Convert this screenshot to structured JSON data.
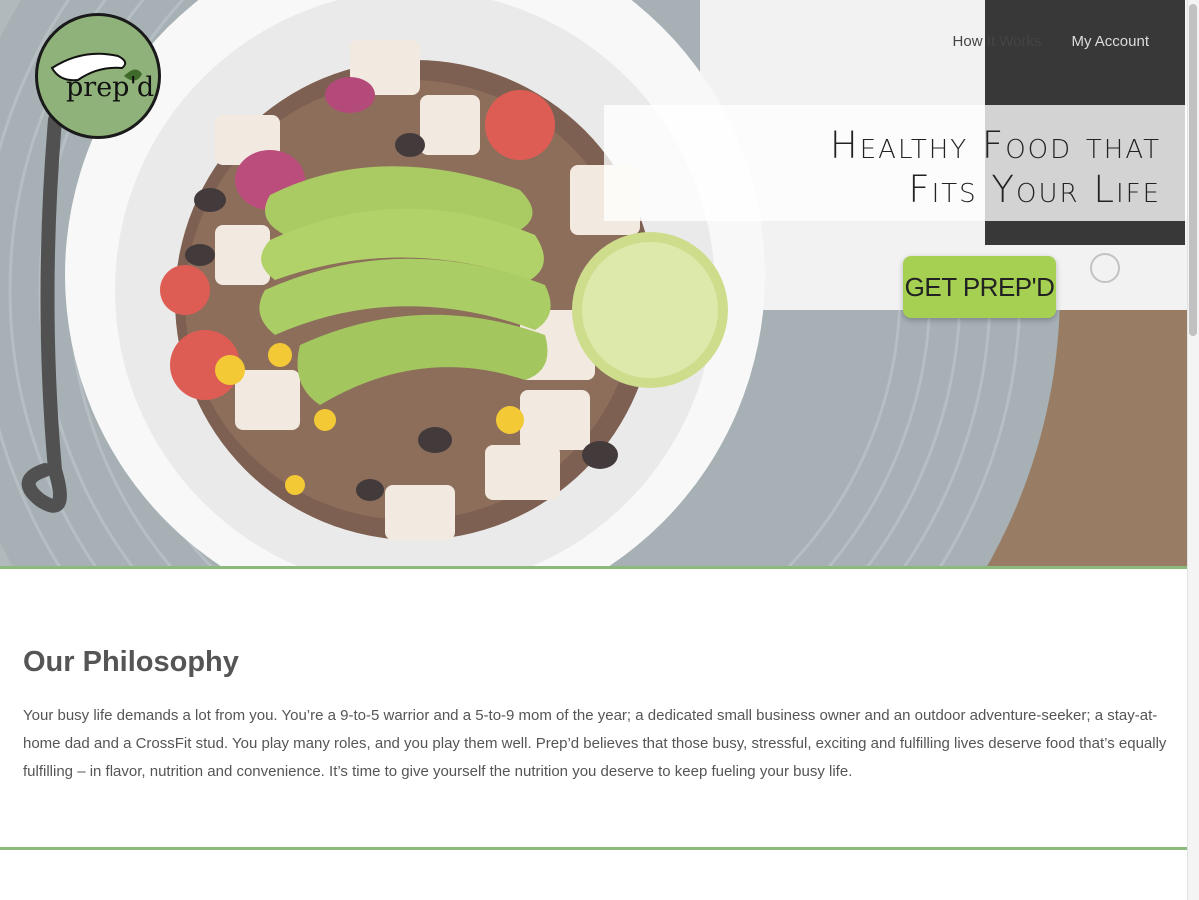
{
  "nav": {
    "how_it_works": "How It Works",
    "my_account": "My Account"
  },
  "logo": {
    "text": "prep'd"
  },
  "hero": {
    "tagline_line1": "Healthy Food that",
    "tagline_line2": "Fits Your Life",
    "cta_label": "GET PREP'D"
  },
  "philosophy": {
    "heading": "Our Philosophy",
    "body": "Your busy life demands a lot from you. You’re a 9-to-5 warrior and a 5-to-9 mom of the year; a dedicated small business owner and an outdoor adventure-seeker; a stay-at-home dad and a CrossFit stud. You play many roles, and you play them well. Prep’d believes that those busy, stressful, exciting and fulfilling lives deserve food that’s equally fulfilling – in flavor, nutrition and convenience. It’s time to give yourself the nutrition you deserve to keep fueling your busy life."
  },
  "colors": {
    "accent_green": "#8cba7c",
    "cta_green": "#a6d052",
    "logo_green": "#8fb27a"
  }
}
